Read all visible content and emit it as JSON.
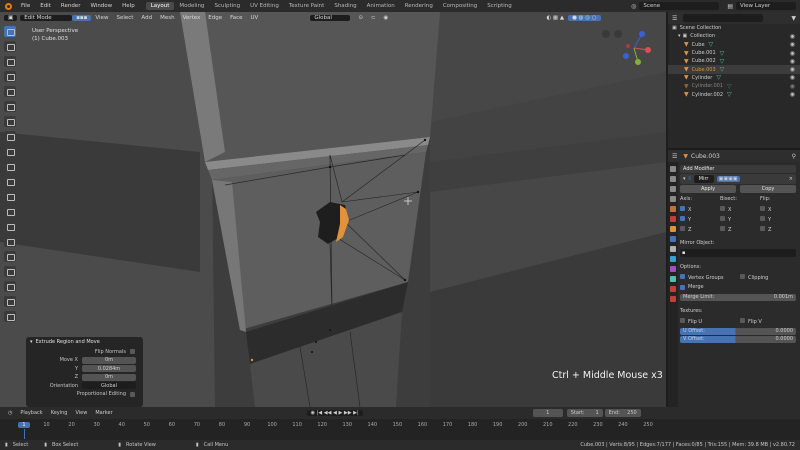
{
  "menu": [
    "File",
    "Edit",
    "Render",
    "Window",
    "Help"
  ],
  "workspaces": [
    "Layout",
    "Modeling",
    "Sculpting",
    "UV Editing",
    "Texture Paint",
    "Shading",
    "Animation",
    "Rendering",
    "Compositing",
    "Scripting"
  ],
  "active_workspace": "Layout",
  "scene": "Scene",
  "view_layer": "View Layer",
  "viewport": {
    "mode": "Edit Mode",
    "menus": [
      "View",
      "Select",
      "Add",
      "Mesh",
      "Vertex",
      "Edge",
      "Face",
      "UV"
    ],
    "transform_orientation": "Global",
    "perspective_label": "User Perspective",
    "object_label": "(1) Cube.003"
  },
  "outliner": {
    "root": "Scene Collection",
    "collection": "Collection",
    "items": [
      {
        "name": "Cube",
        "selected": false,
        "dim": false
      },
      {
        "name": "Cube.001",
        "selected": false,
        "dim": false
      },
      {
        "name": "Cube.002",
        "selected": false,
        "dim": false
      },
      {
        "name": "Cube.003",
        "selected": true,
        "dim": false
      },
      {
        "name": "Cylinder",
        "selected": false,
        "dim": false
      },
      {
        "name": "Cylinder.001",
        "selected": false,
        "dim": true
      },
      {
        "name": "Cylinder.002",
        "selected": false,
        "dim": false
      }
    ]
  },
  "properties": {
    "object": "Cube.003",
    "add_modifier": "Add Modifier",
    "modifier_name": "Mirr",
    "apply": "Apply",
    "copy": "Copy",
    "axis_label": "Axis:",
    "bisect_label": "Bisect:",
    "flip_label": "Flip:",
    "axes": [
      "X",
      "Y",
      "Z"
    ],
    "mirror_object": "Mirror Object:",
    "options": "Options:",
    "vertex_groups": "Vertex Groups",
    "clipping": "Clipping",
    "merge": "Merge",
    "merge_limit_label": "Merge Limit:",
    "merge_limit_value": "0.001m",
    "textures": "Textures:",
    "flip_u": "Flip U",
    "flip_v": "Flip V",
    "u_offset_label": "U Offset:",
    "u_offset_value": "0.0000",
    "v_offset_label": "V Offset:",
    "v_offset_value": "0.0000"
  },
  "redo_panel": {
    "title": "Extrude Region and Move",
    "flip_normals": "Flip Normals",
    "move_x_label": "Move X",
    "move_x": "0m",
    "y_label": "Y",
    "y": "0.0284m",
    "z_label": "Z",
    "z": "0m",
    "orientation_label": "Orientation",
    "orientation": "Global",
    "proportional_editing": "Proportional Editing"
  },
  "hint": "Ctrl + Middle Mouse x3",
  "timeline": {
    "menus": [
      "Playback",
      "Keying",
      "View",
      "Marker"
    ],
    "current_frame": "1",
    "start_label": "Start:",
    "start": "1",
    "end_label": "End:",
    "end": "250",
    "ticks": [
      "1",
      "10",
      "20",
      "30",
      "40",
      "50",
      "60",
      "70",
      "80",
      "90",
      "100",
      "110",
      "120",
      "130",
      "140",
      "150",
      "160",
      "170",
      "180",
      "190",
      "200",
      "210",
      "220",
      "230",
      "240",
      "250"
    ]
  },
  "status": {
    "select": "Select",
    "box_select": "Box Select",
    "rotate_view": "Rotate View",
    "call_menu": "Call Menu",
    "stats": "Cube.003 | Verts:8/95 | Edges:7/177 | Faces:0/85 | Tris:155 | Mem: 39.8 MB | v2.80.72"
  },
  "colors": {
    "accent": "#4772b3",
    "mesh_orange": "#e2923a",
    "background": "#3d3d3d"
  }
}
